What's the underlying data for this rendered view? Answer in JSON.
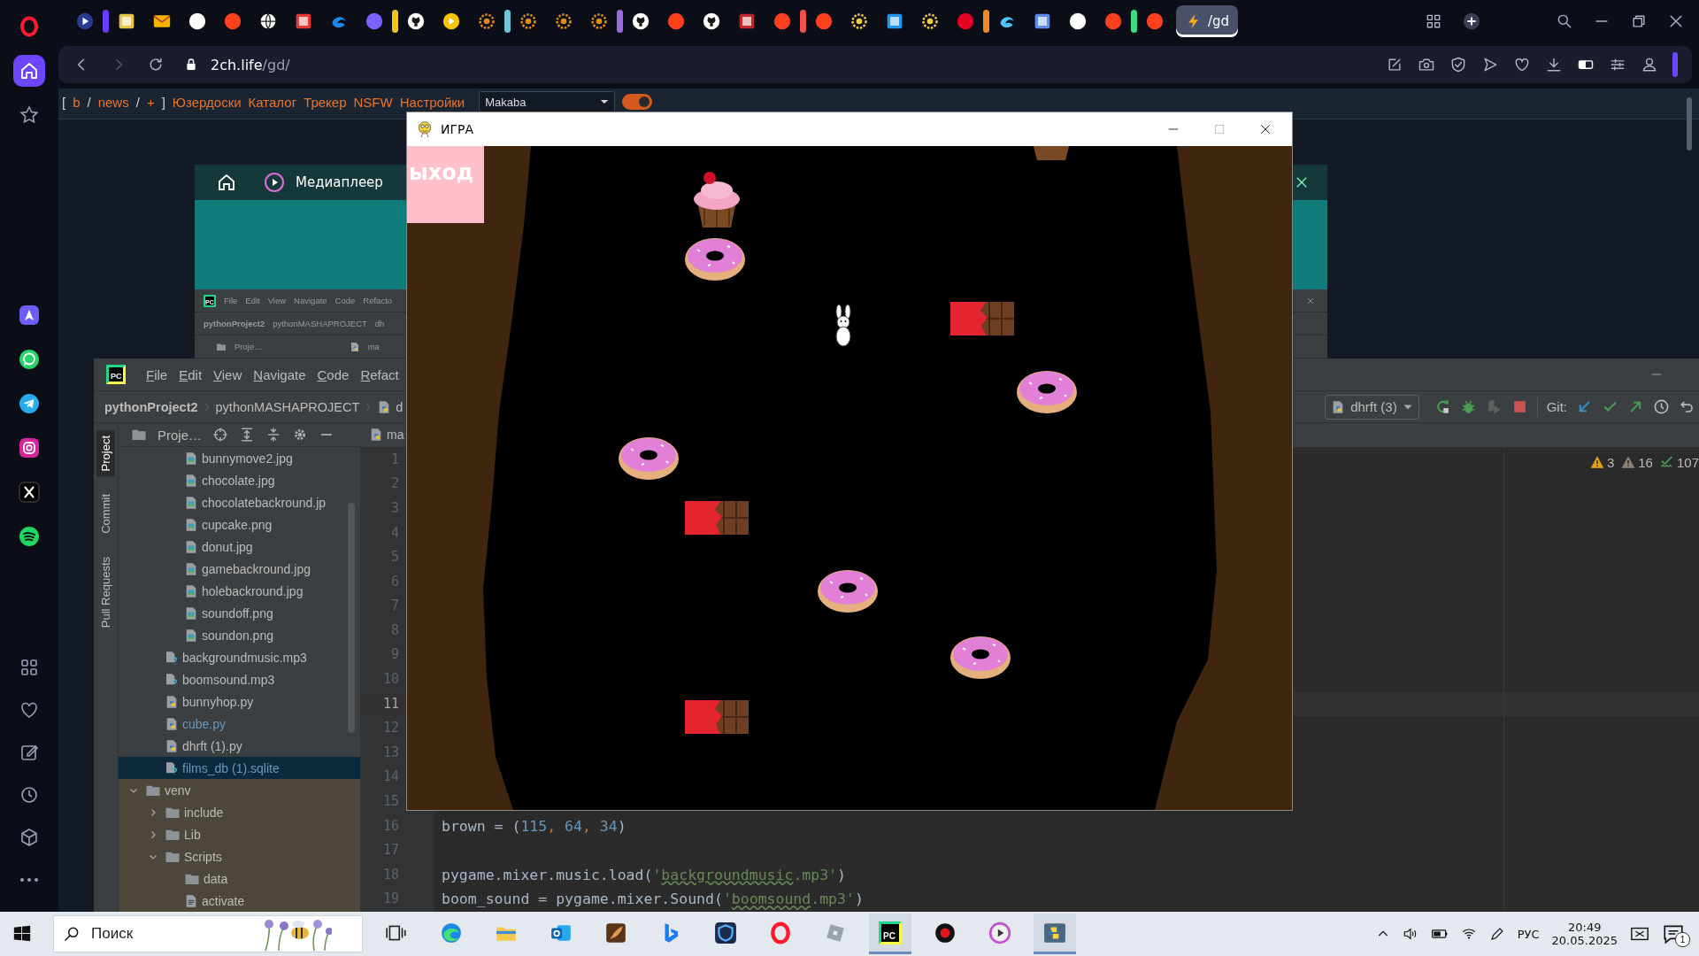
{
  "browser": {
    "sidebar": {
      "top": [
        {
          "kind": "opera",
          "selected": false
        },
        {
          "kind": "home",
          "selected": true
        },
        {
          "kind": "star",
          "selected": false
        }
      ],
      "apps": [
        {
          "kind": "aria",
          "selected": false
        },
        {
          "kind": "whatsapp",
          "selected": false
        },
        {
          "kind": "telegram",
          "selected": false
        },
        {
          "kind": "instagram",
          "selected": false
        },
        {
          "kind": "x",
          "selected": false
        },
        {
          "kind": "spotify",
          "selected": false
        }
      ],
      "bottom": [
        {
          "kind": "apps",
          "selected": false
        },
        {
          "kind": "heart",
          "selected": false
        },
        {
          "kind": "edit",
          "selected": false
        },
        {
          "kind": "history",
          "selected": false
        },
        {
          "kind": "box",
          "selected": false
        },
        {
          "kind": "more",
          "selected": false
        }
      ]
    },
    "tabs": [
      {
        "kind": "play",
        "color": "#2b3a8f",
        "selected": false
      },
      {
        "kind": "group",
        "color": "#6a3cff"
      },
      {
        "kind": "square",
        "color": "#e8c24a",
        "selected": false
      },
      {
        "kind": "mail",
        "color": "#f4b400",
        "selected": false
      },
      {
        "kind": "circle",
        "color": "#ffffff",
        "selected": false
      },
      {
        "kind": "circle",
        "color": "#fc3f1d",
        "selected": false
      },
      {
        "kind": "globe",
        "color": "#ffffff",
        "selected": false
      },
      {
        "kind": "square",
        "color": "#e53935",
        "selected": false
      },
      {
        "kind": "swirl",
        "color": "#1e88e5",
        "selected": false
      },
      {
        "kind": "circle",
        "color": "#7b61ff",
        "selected": false
      },
      {
        "kind": "group",
        "color": "#f0c419"
      },
      {
        "kind": "github",
        "color": "#ffffff",
        "selected": false
      },
      {
        "kind": "play",
        "color": "#f7c600",
        "selected": false
      },
      {
        "kind": "sun",
        "color": "#e08a1e",
        "selected": false
      },
      {
        "kind": "group",
        "color": "#6ec6d8"
      },
      {
        "kind": "sun",
        "color": "#e08a1e",
        "selected": false
      },
      {
        "kind": "sun",
        "color": "#e08a1e",
        "selected": false
      },
      {
        "kind": "sun",
        "color": "#e08a1e",
        "selected": false
      },
      {
        "kind": "group",
        "color": "#9c6ade"
      },
      {
        "kind": "github",
        "color": "#ffffff",
        "selected": false
      },
      {
        "kind": "circle",
        "color": "#fc3f1d",
        "selected": false
      },
      {
        "kind": "github",
        "color": "#ffffff",
        "selected": false
      },
      {
        "kind": "square",
        "color": "#c62828",
        "selected": false
      },
      {
        "kind": "circle",
        "color": "#fc3f1d",
        "selected": false
      },
      {
        "kind": "group",
        "color": "#ef5350"
      },
      {
        "kind": "circle",
        "color": "#fc3f1d",
        "selected": false
      },
      {
        "kind": "sun",
        "color": "#f2c94c",
        "selected": false
      },
      {
        "kind": "square",
        "color": "#2196f3",
        "selected": false
      },
      {
        "kind": "sun",
        "color": "#f2c94c",
        "selected": false
      },
      {
        "kind": "circle",
        "color": "#e60023",
        "selected": false
      },
      {
        "kind": "group",
        "color": "#f08a24"
      },
      {
        "kind": "swirl",
        "color": "#4fc3f7",
        "selected": false
      },
      {
        "kind": "square",
        "color": "#5b8def",
        "selected": false
      },
      {
        "kind": "circle",
        "color": "#ffffff",
        "selected": false
      },
      {
        "kind": "circle",
        "color": "#fc3f1d",
        "selected": false
      },
      {
        "kind": "group",
        "color": "#3ddc84"
      },
      {
        "kind": "circle",
        "color": "#fc3f1d",
        "selected": false
      },
      {
        "kind": "bolt",
        "color": "#f5a623",
        "selected": true,
        "label": "/gd"
      }
    ],
    "address": {
      "host": "2ch.life",
      "path": "/gd/"
    }
  },
  "page": {
    "nav": [
      {
        "kind": "punct",
        "text": "["
      },
      {
        "kind": "link",
        "text": "b"
      },
      {
        "kind": "punct",
        "text": "/"
      },
      {
        "kind": "link",
        "text": "news"
      },
      {
        "kind": "punct",
        "text": "/"
      },
      {
        "kind": "link",
        "text": "+"
      },
      {
        "kind": "punct",
        "text": "]"
      },
      {
        "kind": "link",
        "text": "Юзердоски"
      },
      {
        "kind": "link",
        "text": "Каталог"
      },
      {
        "kind": "link",
        "text": "Трекер"
      },
      {
        "kind": "link",
        "text": "NSFW"
      },
      {
        "kind": "link",
        "text": "Настройки"
      }
    ],
    "style_select": "Makaba",
    "toggle": {
      "on": true
    }
  },
  "mediaplayer": {
    "title": "Медиаплеер",
    "inner_ide": {
      "logo_text": "PC",
      "menu": [
        "File",
        "Edit",
        "View",
        "Navigate",
        "Code",
        "Refacto"
      ],
      "breadcrumbs": [
        "pythonProject2",
        "pythonMASHAPROJECT",
        "dh"
      ],
      "panel_title": "Proje…",
      "editor_tab": "ma"
    }
  },
  "ide": {
    "logo_text": "PC",
    "menu": [
      "File",
      "Edit",
      "View",
      "Navigate",
      "Code",
      "Refact"
    ],
    "breadcrumbs": [
      "pythonProject2",
      "pythonMASHAPROJECT",
      "d"
    ],
    "side_tabs": [
      {
        "label": "Project",
        "selected": true
      },
      {
        "label": "Commit",
        "selected": false
      },
      {
        "label": "Pull Requests",
        "selected": false
      }
    ],
    "panel_title": "Proje…",
    "editor_tab": "ma",
    "run_config": "dhrft (3)",
    "git_label": "Git:",
    "inspections": [
      {
        "kind": "warning",
        "count": "3"
      },
      {
        "kind": "weak-warning",
        "count": "16"
      },
      {
        "kind": "typo",
        "count": "107"
      }
    ],
    "tree": [
      {
        "children": [
          {
            "children": [
              {
                "name": "bunnymove2.jpg",
                "kind": "image",
                "selected": false,
                "modified": false
              },
              {
                "name": "chocolate.jpg",
                "kind": "image",
                "selected": false,
                "modified": false
              },
              {
                "name": "chocolatebackround.jp",
                "kind": "image",
                "selected": false,
                "modified": false
              },
              {
                "name": "cupcake.png",
                "kind": "image",
                "selected": false,
                "modified": false
              },
              {
                "name": "donut.jpg",
                "kind": "image",
                "selected": false,
                "modified": false
              },
              {
                "name": "gamebackround.jpg",
                "kind": "image",
                "selected": false,
                "modified": false
              },
              {
                "name": "holebackround.jpg",
                "kind": "image",
                "selected": false,
                "modified": false
              },
              {
                "name": "soundoff.png",
                "kind": "image",
                "selected": false,
                "modified": false
              },
              {
                "name": "soundon.png",
                "kind": "image",
                "selected": false,
                "modified": false
              }
            ]
          },
          {
            "name": "backgroundmusic.mp3",
            "kind": "unknown",
            "selected": false,
            "modified": false
          },
          {
            "name": "boomsound.mp3",
            "kind": "unknown",
            "selected": false,
            "modified": false
          },
          {
            "name": "bunnyhop.py",
            "kind": "python",
            "selected": false,
            "modified": false
          },
          {
            "name": "cube.py",
            "kind": "python",
            "selected": false,
            "modified": true
          },
          {
            "name": "dhrft (1).py",
            "kind": "python",
            "selected": false,
            "modified": false
          },
          {
            "name": "films_db (1).sqlite",
            "kind": "unknown",
            "selected": true,
            "modified": true
          }
        ]
      },
      {
        "name": "venv",
        "kind": "excluded-folder",
        "expanded": true,
        "selected": false,
        "modified": false,
        "children": [
          {
            "name": "include",
            "kind": "folder",
            "expanded": false,
            "selected": false,
            "modified": false
          },
          {
            "name": "Lib",
            "kind": "folder",
            "expanded": false,
            "selected": false,
            "modified": false
          },
          {
            "name": "Scripts",
            "kind": "folder",
            "expanded": true,
            "selected": false,
            "modified": false,
            "children": [
              {
                "name": "data",
                "kind": "folder",
                "selected": false,
                "modified": false
              },
              {
                "name": "activate",
                "kind": "script",
                "selected": false,
                "modified": false
              }
            ]
          }
        ]
      }
    ],
    "lines": [
      {
        "number": "1",
        "current": false
      },
      {
        "number": "2",
        "current": false
      },
      {
        "number": "3",
        "current": false
      },
      {
        "number": "4",
        "current": false
      },
      {
        "number": "5",
        "current": false
      },
      {
        "number": "6",
        "current": false
      },
      {
        "number": "7",
        "current": false
      },
      {
        "number": "8",
        "current": false
      },
      {
        "number": "9",
        "current": false
      },
      {
        "number": "10",
        "current": false
      },
      {
        "number": "11",
        "current": true
      },
      {
        "number": "12",
        "current": false
      },
      {
        "number": "13",
        "current": false
      },
      {
        "number": "14",
        "current": false
      },
      {
        "number": "15",
        "current": false
      },
      {
        "number": "16",
        "current": false,
        "tokens": [
          {
            "kind": "plain",
            "text": "brown = ("
          },
          {
            "kind": "number",
            "text": "115"
          },
          {
            "kind": "comma",
            "text": ", "
          },
          {
            "kind": "number",
            "text": "64"
          },
          {
            "kind": "comma",
            "text": ", "
          },
          {
            "kind": "number",
            "text": "34"
          },
          {
            "kind": "plain",
            "text": ")"
          }
        ]
      },
      {
        "number": "17",
        "current": false
      },
      {
        "number": "18",
        "current": false,
        "tokens": [
          {
            "kind": "plain",
            "text": "pygame.mixer.music.load("
          },
          {
            "kind": "string",
            "text": "'"
          },
          {
            "kind": "typo",
            "text": "backgroundmusic"
          },
          {
            "kind": "string",
            "text": ".mp3'"
          },
          {
            "kind": "plain",
            "text": ")"
          }
        ]
      },
      {
        "number": "19",
        "current": false,
        "tokens": [
          {
            "kind": "plain",
            "text": "boom_sound = pygame.mixer.Sound("
          },
          {
            "kind": "string",
            "text": "'"
          },
          {
            "kind": "typo",
            "text": "boomsound"
          },
          {
            "kind": "string",
            "text": ".mp3'"
          },
          {
            "kind": "plain",
            "text": ")"
          }
        ]
      }
    ]
  },
  "game": {
    "title": "ИГРА",
    "exit_label": "ыход"
  },
  "taskbar": {
    "search": {
      "placeholder": "Поиск"
    },
    "apps": [
      {
        "kind": "taskview",
        "active": false
      },
      {
        "kind": "edge",
        "active": false
      },
      {
        "kind": "explorer",
        "active": false
      },
      {
        "kind": "outlook",
        "active": false
      },
      {
        "kind": "feather",
        "active": false
      },
      {
        "kind": "bing",
        "active": false
      },
      {
        "kind": "shield",
        "active": false
      },
      {
        "kind": "opera",
        "active": false
      },
      {
        "kind": "roblox",
        "active": false
      },
      {
        "kind": "pycharm",
        "active": true,
        "label": "PC"
      },
      {
        "kind": "record",
        "active": false
      },
      {
        "kind": "player",
        "active": false
      },
      {
        "kind": "python",
        "active": true
      }
    ],
    "language": "РУС",
    "time": "20:49",
    "date": "20.05.2025",
    "notification_count": "1"
  }
}
